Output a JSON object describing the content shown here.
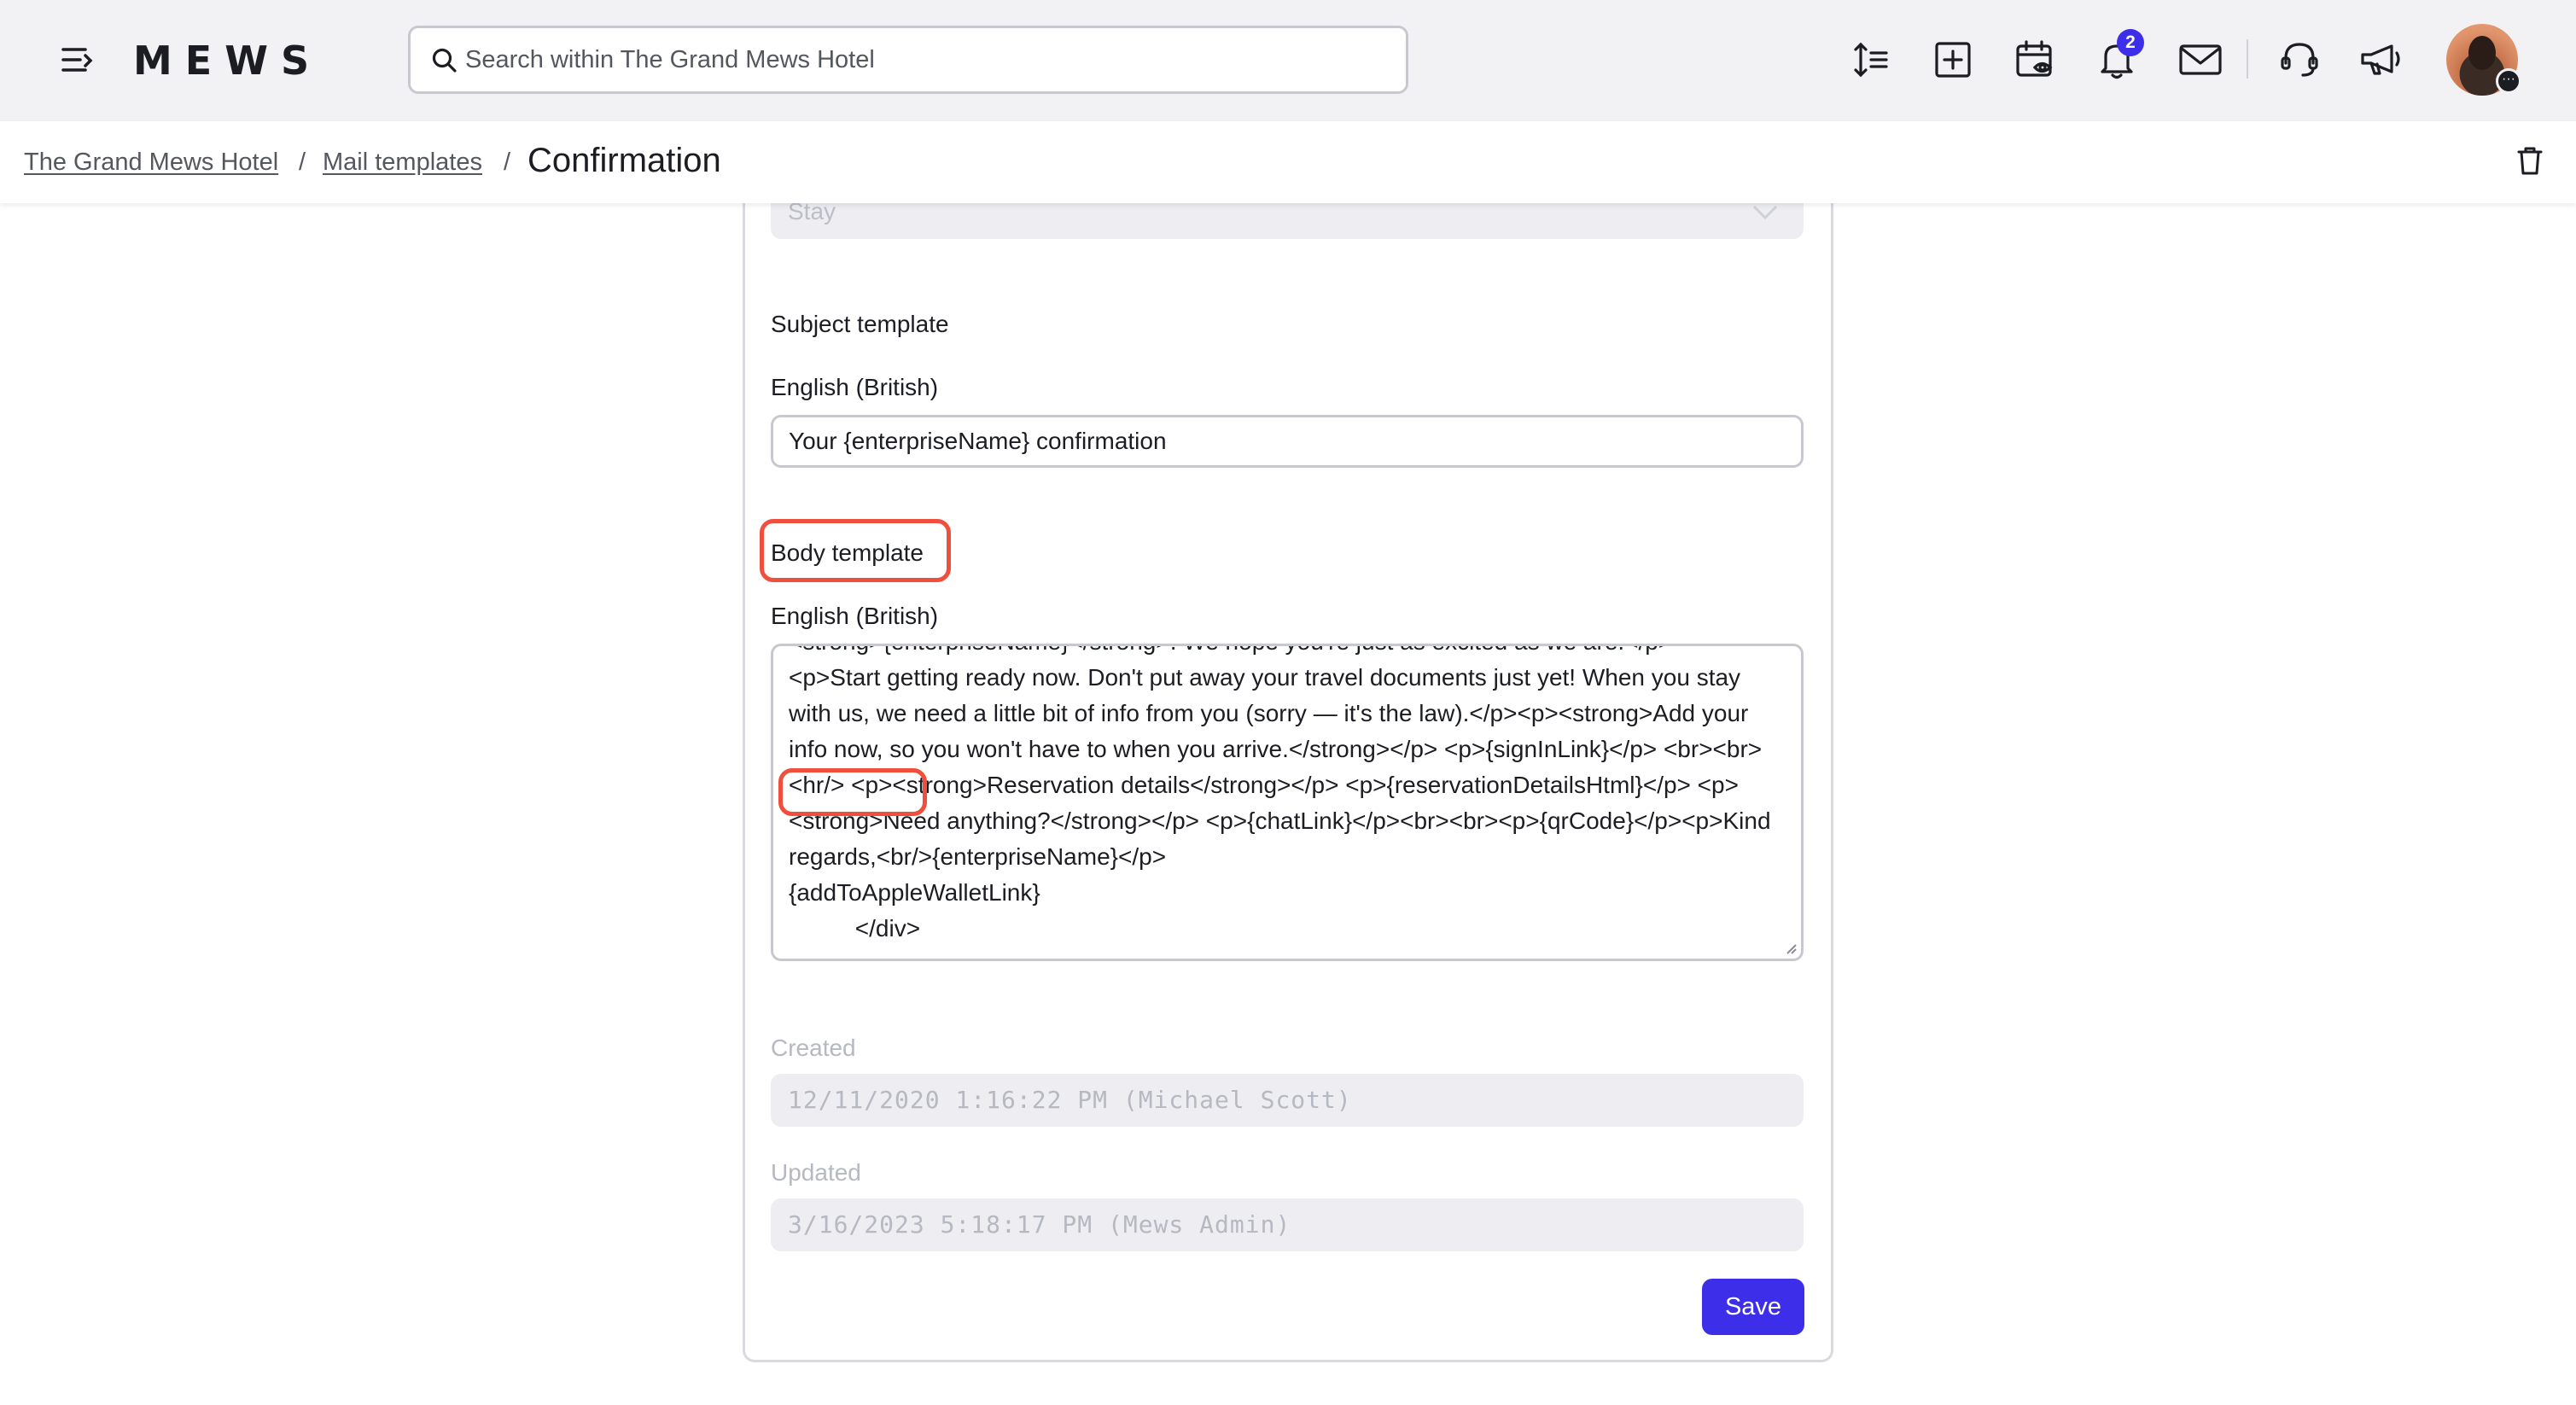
{
  "header": {
    "logo": "MEWS",
    "search_placeholder": "Search within The Grand Mews Hotel",
    "notifications_count": "2",
    "icons": [
      "hamburger-icon",
      "search-icon",
      "sort-lines-icon",
      "plus-square-icon",
      "calendar-eye-icon",
      "bell-icon",
      "mail-icon",
      "headset-icon",
      "megaphone-icon",
      "avatar"
    ]
  },
  "breadcrumb": {
    "hotel": "The Grand Mews Hotel",
    "sep1": "/",
    "section": "Mail templates",
    "sep2": "/",
    "current": "Confirmation"
  },
  "form": {
    "type_value": "Stay",
    "subject_heading": "Subject template",
    "subject_lang": "English (British)",
    "subject_value": "Your {enterpriseName} confirmation",
    "body_heading": "Body template",
    "body_lang": "English (British)",
    "body_value": "<strong>{enterpriseName}</strong>. We hope you're just as excited as we are.</p>\n<p>Start getting ready now. Don't put away your travel documents just yet! When you stay with us, we need a little bit of info from you (sorry — it's the law).</p><p><strong>Add your info now, so you won't have to when you arrive.</strong></p> <p>{signInLink}</p> <br><br><hr/> <p><strong>Reservation details</strong></p> <p>{reservationDetailsHtml}</p> <p><strong>Need anything?</strong></p> <p>{chatLink}</p><br><br><p>{qrCode}</p><p>Kind regards,<br/>{enterpriseName}</p>\n{addToAppleWalletLink}\n          </div>",
    "created_label": "Created",
    "created_value": "12/11/2020 1:16:22 PM (Michael Scott)",
    "updated_label": "Updated",
    "updated_value": "3/16/2023 5:18:17 PM (Mews Admin)",
    "save_label": "Save"
  },
  "colors": {
    "accent": "#3d2fe9",
    "highlight": "#f04f3e",
    "topbar_bg": "#f2f2f4"
  }
}
